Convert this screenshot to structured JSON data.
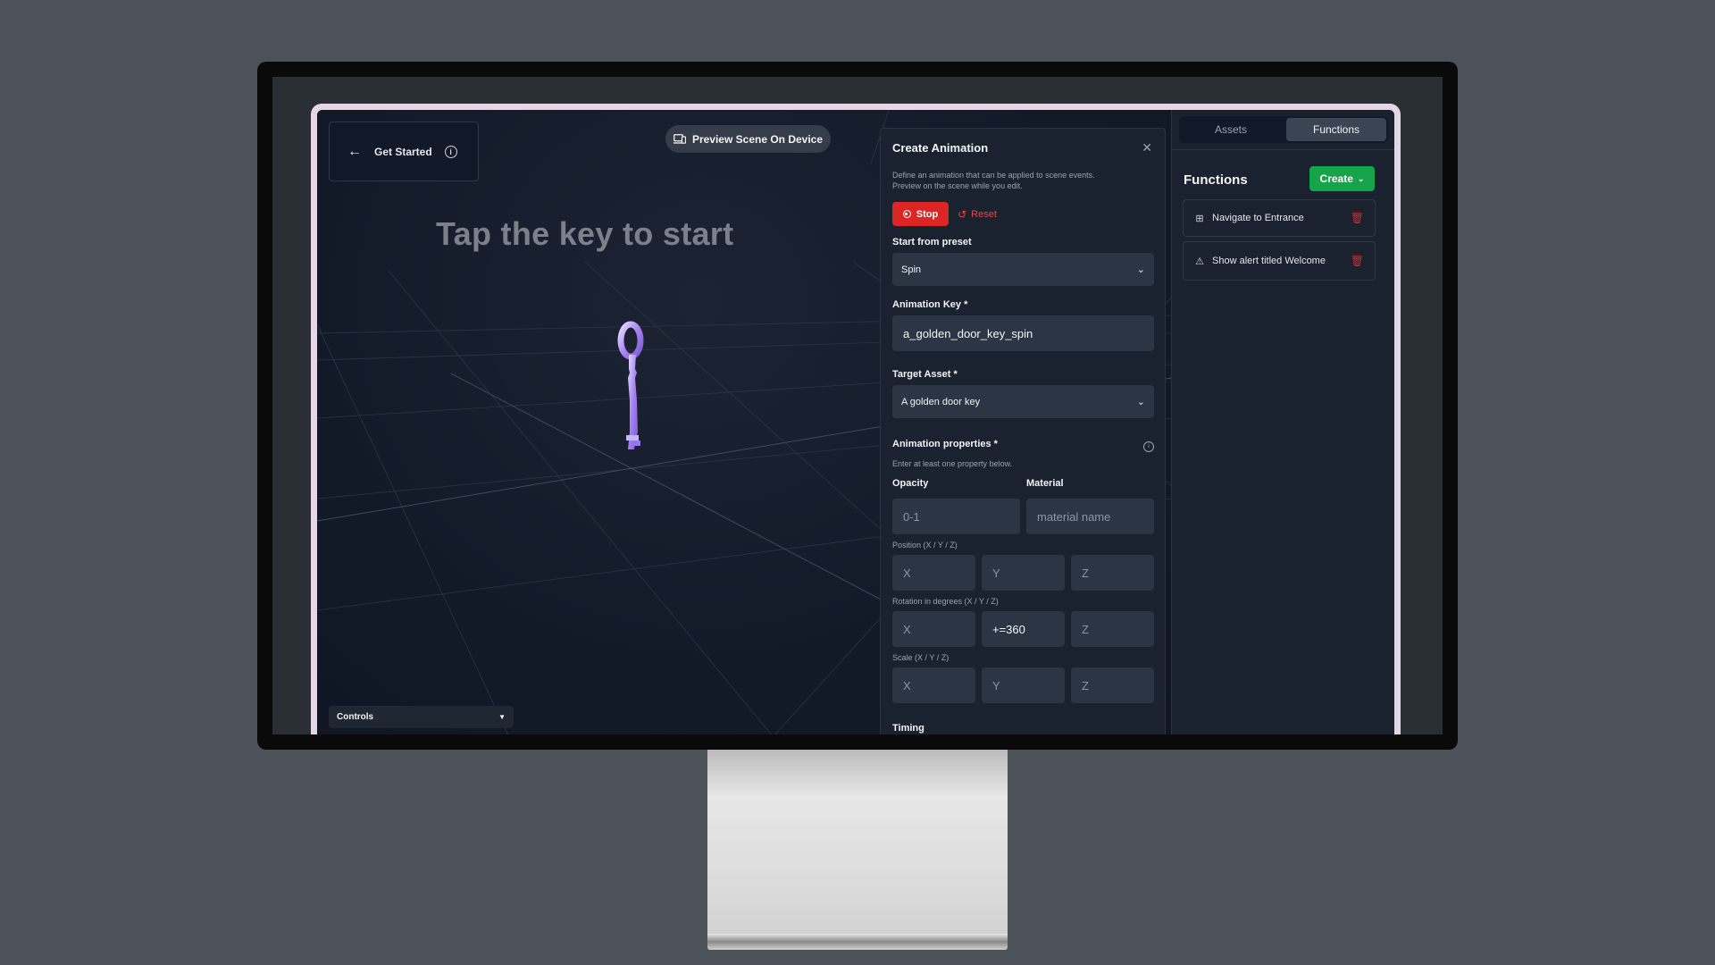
{
  "viewport": {
    "get_started_label": "Get Started",
    "preview_button_label": "Preview Scene On Device",
    "scene_heading": "Tap the key to start",
    "controls_label": "Controls"
  },
  "panel": {
    "title": "Create Animation",
    "description": "Define an animation that can be applied to scene events. Preview on the scene while you edit.",
    "stop_label": "Stop",
    "reset_label": "Reset",
    "preset_label": "Start from preset",
    "preset_value": "Spin",
    "key_label": "Animation Key *",
    "key_value": "a_golden_door_key_spin",
    "target_label": "Target Asset *",
    "target_value": "A golden door key",
    "props_label": "Animation properties *",
    "props_hint": "Enter at least one property below.",
    "opacity_label": "Opacity",
    "opacity_placeholder": "0-1",
    "material_label": "Material",
    "material_placeholder": "material name",
    "position_label": "Position (X / Y / Z)",
    "rotation_label": "Rotation in degrees (X / Y / Z)",
    "rotation_y_value": "+=360",
    "scale_label": "Scale (X / Y / Z)",
    "axis_x": "X",
    "axis_y": "Y",
    "axis_z": "Z",
    "timing_label": "Timing"
  },
  "sidebar": {
    "tabs": [
      {
        "label": "Assets",
        "active": false
      },
      {
        "label": "Functions",
        "active": true
      }
    ],
    "heading": "Functions",
    "create_label": "Create",
    "functions": [
      {
        "label": "Navigate to Entrance",
        "icon": "navigate-icon"
      },
      {
        "label": "Show alert titled Welcome",
        "icon": "alert-triangle-icon"
      }
    ]
  },
  "colors": {
    "primary_danger": "#dc2626",
    "create_green": "#16a34a",
    "panel_bg": "#1a2230",
    "viewport_bg": "#121a28"
  }
}
